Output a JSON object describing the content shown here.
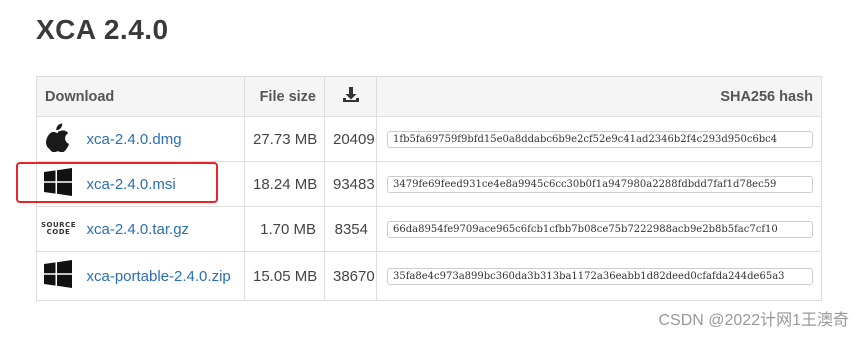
{
  "page": {
    "title": "XCA 2.4.0"
  },
  "table": {
    "headers": {
      "download": "Download",
      "file_size": "File size",
      "download_count_icon": "download-count-icon",
      "sha": "SHA256 hash"
    },
    "rows": [
      {
        "icon": "apple-icon",
        "name": "xca-2.4.0.dmg",
        "size": "27.73 MB",
        "count": "20409",
        "sha": "1fb5fa69759f9bfd15e0a8ddabc6b9e2cf52e9c41ad2346b2f4c293d950c6bc4"
      },
      {
        "icon": "windows-icon",
        "name": "xca-2.4.0.msi",
        "size": "18.24 MB",
        "count": "93483",
        "sha": "3479fe69feed931ce4e8a9945c6cc30b0f1a947980a2288fdbdd7faf1d78ec59"
      },
      {
        "icon": "source-code-icon",
        "icon_text": "SOURCE\nCODE",
        "name": "xca-2.4.0.tar.gz",
        "size": "1.70 MB",
        "count": "8354",
        "sha": "66da8954fe9709ace965c6fcb1cfbb7b08ce75b7222988acb9e2b8b5fac7cf10"
      },
      {
        "icon": "windows-icon",
        "name": "xca-portable-2.4.0.zip",
        "size": "15.05 MB",
        "count": "38670",
        "sha": "35fa8e4c973a899bc360da3b313ba1172a36eabb1d82deed0cfafda244de65a3"
      }
    ]
  },
  "annotation": {
    "color": "#e8242a",
    "highlighted_row": "xca-2.4.0.msi"
  },
  "watermark": "CSDN @2022计网1王澳奇",
  "colors": {
    "link": "#2a6eb5",
    "header_bg": "#f5f5f5",
    "border": "#dddddd"
  }
}
